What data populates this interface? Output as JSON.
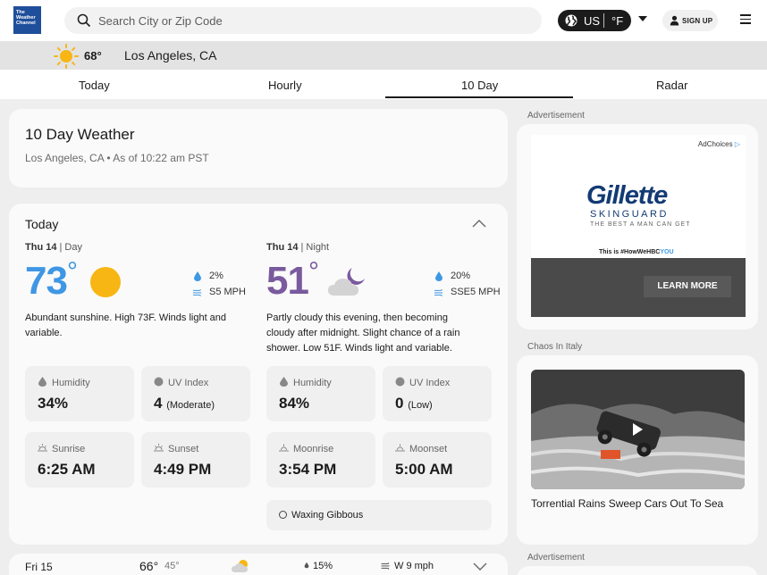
{
  "brand": {
    "logo_text": "The Weather Channel",
    "color": "#1f4e9b"
  },
  "search": {
    "placeholder": "Search City or Zip Code"
  },
  "units": {
    "region": "US",
    "temp_unit": "°F"
  },
  "account": {
    "signup_label": "SIGN UP"
  },
  "current": {
    "temp": "68°",
    "location": "Los Angeles, CA"
  },
  "tabs": [
    {
      "label": "Today"
    },
    {
      "label": "Hourly"
    },
    {
      "label": "10 Day",
      "active": true
    },
    {
      "label": "Radar"
    }
  ],
  "header_card": {
    "title": "10 Day Weather",
    "subtitle": "Los Angeles, CA • As of 10:22 am PST"
  },
  "today": {
    "label": "Today",
    "day": {
      "period_day": "Thu 14",
      "period_part": "| Day",
      "temp": "73",
      "deg": "°",
      "precip": "2%",
      "wind": "S5 MPH",
      "narrative": "Abundant sunshine. High 73F. Winds light and variable.",
      "humidity_label": "Humidity",
      "humidity": "34%",
      "uv_label": "UV Index",
      "uv_value": "4",
      "uv_desc": "(Moderate)",
      "sunrise_label": "Sunrise",
      "sunrise": "6:25 AM",
      "sunset_label": "Sunset",
      "sunset": "4:49 PM"
    },
    "night": {
      "period_day": "Thu 14",
      "period_part": "| Night",
      "temp": "51",
      "deg": "°",
      "precip": "20%",
      "wind": "SSE5 MPH",
      "narrative": "Partly cloudy this evening, then becoming cloudy after midnight. Slight chance of a rain shower. Low 51F. Winds light and variable.",
      "humidity_label": "Humidity",
      "humidity": "84%",
      "uv_label": "UV Index",
      "uv_value": "0",
      "uv_desc": "(Low)",
      "moonrise_label": "Moonrise",
      "moonrise": "3:54 PM",
      "moonset_label": "Moonset",
      "moonset": "5:00 AM",
      "moon_phase": "Waxing Gibbous"
    }
  },
  "next_day": {
    "day": "Fri 15",
    "high": "66°",
    "low": "45°",
    "precip": "15%",
    "wind": "W 9 mph"
  },
  "sidebar": {
    "ad_label": "Advertisement",
    "ad": {
      "adchoices": "AdChoices",
      "brand": "Gillette",
      "product": "SKINGUARD",
      "tagline": "THE BEST A MAN CAN GET",
      "hashtag_prefix": "This is #HowWeHBC",
      "hashtag_suffix": "YOU",
      "cta": "LEARN MORE"
    },
    "video_section_label": "Chaos In Italy",
    "video_title": "Torrential Rains Sweep Cars Out To Sea",
    "ad_label_2": "Advertisement"
  },
  "colors": {
    "day_temp": "#3f97e4",
    "night_temp": "#7a5a9e",
    "sun": "#f7b614",
    "accent_blue": "#3f97e4"
  }
}
